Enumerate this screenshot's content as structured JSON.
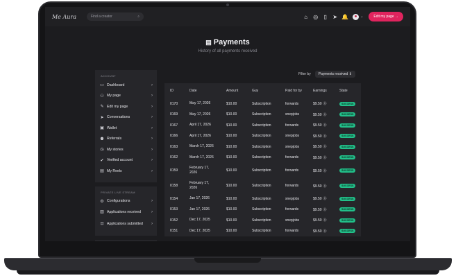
{
  "topbar": {
    "logo": "Me Aura",
    "search_placeholder": "Find a creator",
    "edit_button": "Edit my page →",
    "icons": [
      "home-icon",
      "compass-icon",
      "clipboard-icon",
      "send-icon",
      "bell-icon"
    ]
  },
  "page": {
    "title": "Payments",
    "subtitle": "History of all payments received"
  },
  "sidebar": {
    "account_header": "ACCOUNT",
    "items": [
      {
        "label": "Dashboard",
        "icon": "🖴"
      },
      {
        "label": "My page",
        "icon": "👤"
      },
      {
        "label": "Edit my page",
        "icon": "✎"
      },
      {
        "label": "Conversations",
        "icon": "➤"
      },
      {
        "label": "Wallet",
        "icon": "▣"
      },
      {
        "label": "Referrals",
        "icon": "👥"
      },
      {
        "label": "My stories",
        "icon": "◷"
      },
      {
        "label": "Verified account",
        "icon": "✔"
      },
      {
        "label": "My Reels",
        "icon": "▤"
      }
    ],
    "live_header": "PRIVATE LIVE STREAM",
    "live_items": [
      {
        "label": "Configurations",
        "icon": "⚙"
      },
      {
        "label": "Applications received",
        "icon": "▥"
      },
      {
        "label": "Applications submitted",
        "icon": "⊡"
      }
    ]
  },
  "filter": {
    "label": "Filter by",
    "value": "Payments received ⇕"
  },
  "table": {
    "headers": [
      "ID",
      "Date",
      "Amount",
      "Guy",
      "Paid for by",
      "Earnings",
      "State"
    ],
    "rows": [
      {
        "id": "0170",
        "date": "May 17, 2026",
        "amount": "$10.00",
        "guy": "Subscription",
        "paid": "forwards",
        "earn": "$9.50",
        "state": "SUCCESS"
      },
      {
        "id": "0169",
        "date": "May 17, 2026",
        "amount": "$10.00",
        "guy": "Subscription",
        "paid": "snepjobs",
        "earn": "$9.50",
        "state": "SUCCESS"
      },
      {
        "id": "0167",
        "date": "April 17, 2026",
        "amount": "$10.00",
        "guy": "Subscription",
        "paid": "forwards",
        "earn": "$9.50",
        "state": "SUCCESS"
      },
      {
        "id": "0166",
        "date": "April 17, 2026",
        "amount": "$10.00",
        "guy": "Subscription",
        "paid": "snepjobs",
        "earn": "$9.50",
        "state": "SUCCESS"
      },
      {
        "id": "0163",
        "date": "March 17, 2026",
        "amount": "$10.00",
        "guy": "Subscription",
        "paid": "snepjobs",
        "earn": "$9.50",
        "state": "SUCCESS"
      },
      {
        "id": "0162",
        "date": "March 17, 2026",
        "amount": "$10.00",
        "guy": "Subscription",
        "paid": "forwards",
        "earn": "$9.50",
        "state": "SUCCESS"
      },
      {
        "id": "0159",
        "date": "February 17, 2026",
        "amount": "$10.00",
        "guy": "Subscription",
        "paid": "forwards",
        "earn": "$9.50",
        "state": "SUCCESS"
      },
      {
        "id": "0158",
        "date": "February 17, 2026",
        "amount": "$10.00",
        "guy": "Subscription",
        "paid": "forwards",
        "earn": "$9.50",
        "state": "SUCCESS"
      },
      {
        "id": "0154",
        "date": "Jan 17, 2026",
        "amount": "$10.00",
        "guy": "Subscription",
        "paid": "snepjobs",
        "earn": "$9.50",
        "state": "SUCCESS"
      },
      {
        "id": "0153",
        "date": "Jan 17, 2026",
        "amount": "$10.00",
        "guy": "Subscription",
        "paid": "forwards",
        "earn": "$9.50",
        "state": "SUCCESS"
      },
      {
        "id": "0152",
        "date": "Dec 17, 2025",
        "amount": "$10.00",
        "guy": "Subscription",
        "paid": "snepjobs",
        "earn": "$9.50",
        "state": "SUCCESS"
      },
      {
        "id": "0151",
        "date": "Dec 17, 2025",
        "amount": "$10.00",
        "guy": "Subscription",
        "paid": "forwards",
        "earn": "$9.50",
        "state": "SUCCESS"
      }
    ]
  },
  "colors": {
    "accent": "#e0245e",
    "success": "#22c08a",
    "panel": "#26262a",
    "background": "#1c1c1f"
  }
}
